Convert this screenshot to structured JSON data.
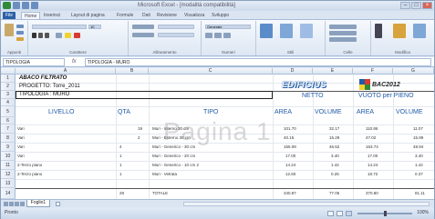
{
  "window": {
    "title": "Microsoft Excel - [modalità compatibilità]",
    "controls": [
      "–",
      "□",
      "×"
    ]
  },
  "tabs": [
    "File",
    "Home",
    "Inserisci",
    "Layout di pagina",
    "Formule",
    "Dati",
    "Revisione",
    "Visualizza",
    "Sviluppo"
  ],
  "ribbon": {
    "groups": [
      "Appunti",
      "Carattere",
      "Allineamento",
      "Numeri",
      "Stili",
      "Celle",
      "Modifica"
    ],
    "font_size": "10",
    "number_format": "Generale"
  },
  "formula_bar": {
    "name_box": "TIPOLOGIA",
    "fx": "fx",
    "value": "TIPOLOGIA - MURO"
  },
  "columns": [
    "A",
    "B",
    "C",
    "D",
    "E",
    "F",
    "G"
  ],
  "rows": [
    "1",
    "2",
    "3",
    "4",
    "5",
    "6",
    "7",
    "8",
    "9",
    "10",
    "11",
    "12",
    "13",
    "14"
  ],
  "sheet": {
    "a1": "ABACO FILTRATO",
    "a2": "PROGETTO: Torre_2011",
    "a3": "TIPOLOGIA : MURO",
    "logo": "EDIFICIUS",
    "logo_suffix": "BAC2012",
    "netto": "NETTO",
    "vuoto": "VUOTO per PIENO",
    "h_livello": "LIVELLO",
    "h_qta": "QTA",
    "h_tipo": "TIPO",
    "h_area": "AREA",
    "h_volume": "VOLUME",
    "h_area2": "AREA",
    "h_volume2": "VOLUME",
    "watermark": "Pagina 1",
    "data_rows": [
      {
        "livello": "Vari",
        "qta": "19",
        "tipo": "Muri - Interno 30 cm",
        "a": "101.70",
        "v": "32.17",
        "a2": "110.86",
        "v2": "11.07"
      },
      {
        "livello": "Vari",
        "qta": "2",
        "tipo": "Muri - Esterno 30 cm",
        "a": "40.15",
        "v": "15.29",
        "a2": "47.02",
        "v2": "15.89"
      },
      {
        "livello": "Vari",
        "qta": "4",
        "tipo": "Muri - Generico - 30 cm",
        "a": "155.09",
        "v": "46.52",
        "a2": "163.74",
        "v2": "48.94"
      },
      {
        "livello": "Vari",
        "qta": "1",
        "tipo": "Muri - Generico - 20 cm",
        "a": "17.00",
        "v": "3.40",
        "a2": "17.00",
        "v2": "3.40"
      },
      {
        "livello": "2-Terzo piano",
        "qta": "1",
        "tipo": "Muri - Generico - 10 cm 2",
        "a": "14.24",
        "v": "1.42",
        "a2": "14.24",
        "v2": "1.42"
      },
      {
        "livello": "2-Terzo piano",
        "qta": "1",
        "tipo": "Muri - Vetrata",
        "a": "12.60",
        "v": "0.25",
        "a2": "18.72",
        "v2": "0.37"
      }
    ],
    "total": {
      "qta": "28",
      "label": "TOTALE",
      "a": "340.87",
      "v": "77.05",
      "a2": "370.80",
      "v2": "81.11"
    }
  },
  "sheet_tab": "Foglio1",
  "status": {
    "left": "Pronto",
    "zoom": "100%"
  },
  "colors": {
    "accent": "#1f5aa6",
    "file_tab": "#2a5fa8"
  }
}
